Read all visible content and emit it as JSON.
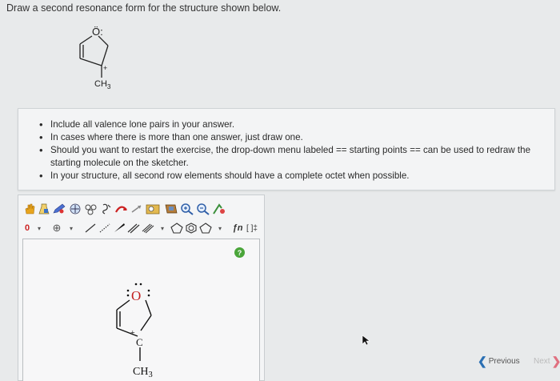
{
  "question": "Draw a second resonance form for the structure shown below.",
  "structure": {
    "oxygen": "Ö:",
    "charge": "+",
    "substituent": "CH3"
  },
  "instructions": [
    "Include all valence lone pairs in your answer.",
    "In cases where there is more than one answer, just draw one.",
    "Should you want to restart the exercise, the drop-down menu labeled == starting points == can be used to redraw the starting molecule on the sketcher.",
    "In your structure, all second row elements should have a complete octet when possible."
  ],
  "toolbar": {
    "charge_value": "0",
    "add_label": "⊕",
    "tool_fn": "ƒn",
    "tool_bracket": "[ ]‡"
  },
  "help_label": "?",
  "sketch": {
    "oxygen": "O",
    "charge": "+",
    "carbon": "C",
    "substituent": "CH3"
  },
  "nav": {
    "previous": "Previous",
    "next": "Next"
  },
  "colors": {
    "page_bg": "#e8eaeb",
    "panel_bg": "#f3f4f5",
    "help_green": "#4aa53a",
    "hand_orange": "#e8a51e",
    "pencil_blue": "#4a6fd1",
    "nav_blue": "#2a6fb3"
  }
}
